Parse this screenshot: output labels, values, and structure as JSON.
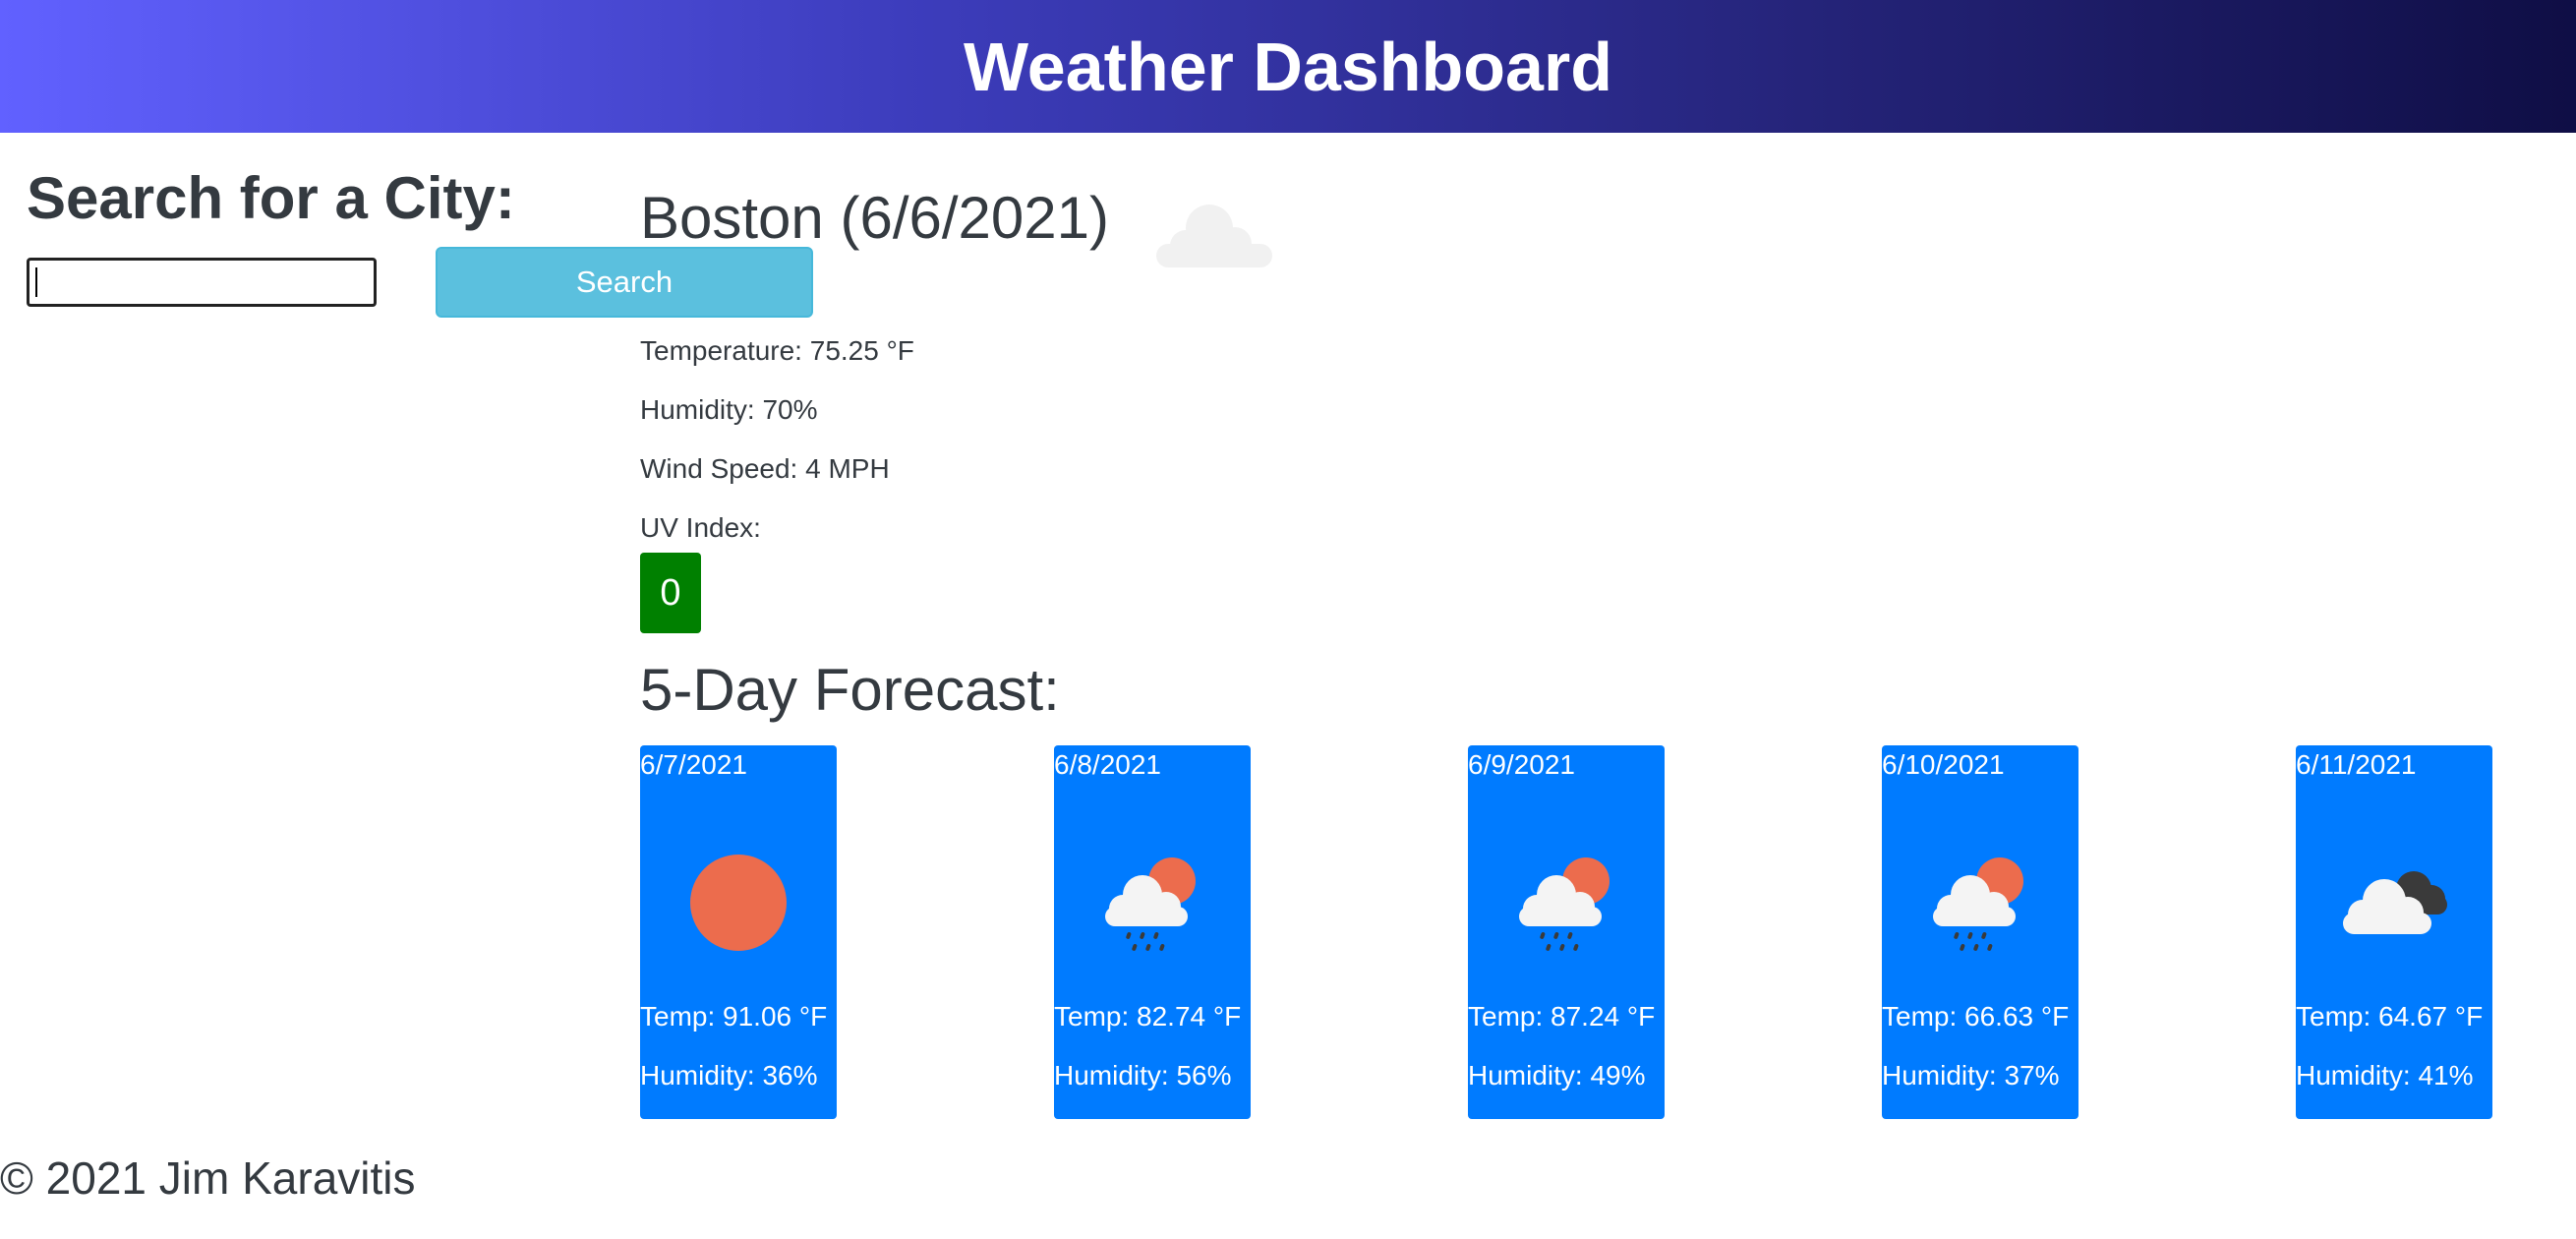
{
  "header": {
    "title": "Weather Dashboard"
  },
  "search": {
    "title": "Search for a City:",
    "input_value": "",
    "button_label": "Search"
  },
  "current": {
    "title": "Boston (6/6/2021)",
    "icon": "cloud-icon",
    "temperature": "Temperature: 75.25 °F",
    "humidity": "Humidity: 70%",
    "wind": "Wind Speed: 4 MPH",
    "uv_label": "UV Index:",
    "uv_value": "0",
    "uv_color": "#008000"
  },
  "forecast": {
    "title": "5-Day Forecast:",
    "card_color": "#007bff",
    "days": [
      {
        "date": "6/7/2021",
        "icon": "sun-icon",
        "temp": "Temp: 91.06 °F",
        "humidity": "Humidity: 36%"
      },
      {
        "date": "6/8/2021",
        "icon": "rain-sun-icon",
        "temp": "Temp: 82.74 °F",
        "humidity": "Humidity: 56%"
      },
      {
        "date": "6/9/2021",
        "icon": "rain-sun-icon",
        "temp": "Temp: 87.24 °F",
        "humidity": "Humidity: 49%"
      },
      {
        "date": "6/10/2021",
        "icon": "rain-sun-icon",
        "temp": "Temp: 66.63 °F",
        "humidity": "Humidity: 37%"
      },
      {
        "date": "6/11/2021",
        "icon": "broken-clouds-icon",
        "temp": "Temp: 64.67 °F",
        "humidity": "Humidity: 41%"
      }
    ]
  },
  "footer": {
    "text": "© 2021 Jim Karavitis"
  }
}
